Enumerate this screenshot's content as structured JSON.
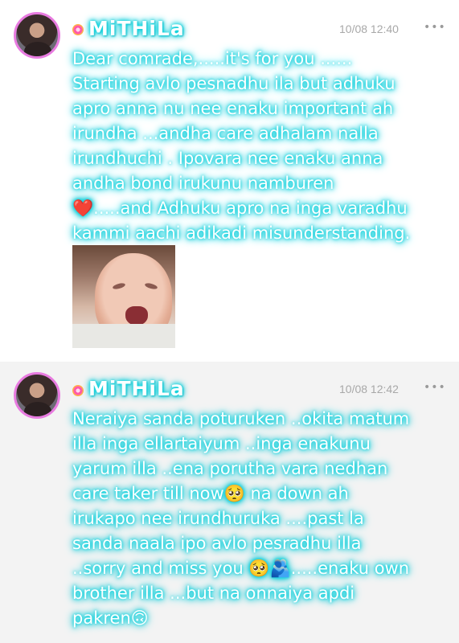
{
  "posts": [
    {
      "username": "MiTHiLa",
      "time": "10/08 12:40",
      "more": "•••",
      "lines": [
        "Dear comrade,.....it's for you ......",
        "Starting avlo pesnadhu ila but adhuku",
        "apro anna nu nee enaku important ah",
        "irundha ...andha care adhalam nalla",
        "irundhuchi . Ipovara nee enaku anna",
        "andha bond irukunu namburen",
        "❤️.....and Adhuku apro na inga varadhu",
        "kammi aachi adikadi misunderstanding."
      ],
      "image": "crying-baby-photo"
    },
    {
      "username": "MiTHiLa",
      "time": "10/08 12:42",
      "more": "•••",
      "lines": [
        "Neraiya sanda poturuken ..okita matum",
        "illa inga ellartaiyum ..inga enakunu",
        "yarum illa ..ena porutha vara nedhan",
        "care taker till now🥺 na down ah",
        "irukapo nee irundhuruka ....past la",
        "sanda naala ipo avlo pesradhu illa",
        "..sorry and miss you 🥺🫂.....enaku own",
        "brother illa ...but na onnaiya apdi",
        "pakren🙃"
      ]
    }
  ]
}
